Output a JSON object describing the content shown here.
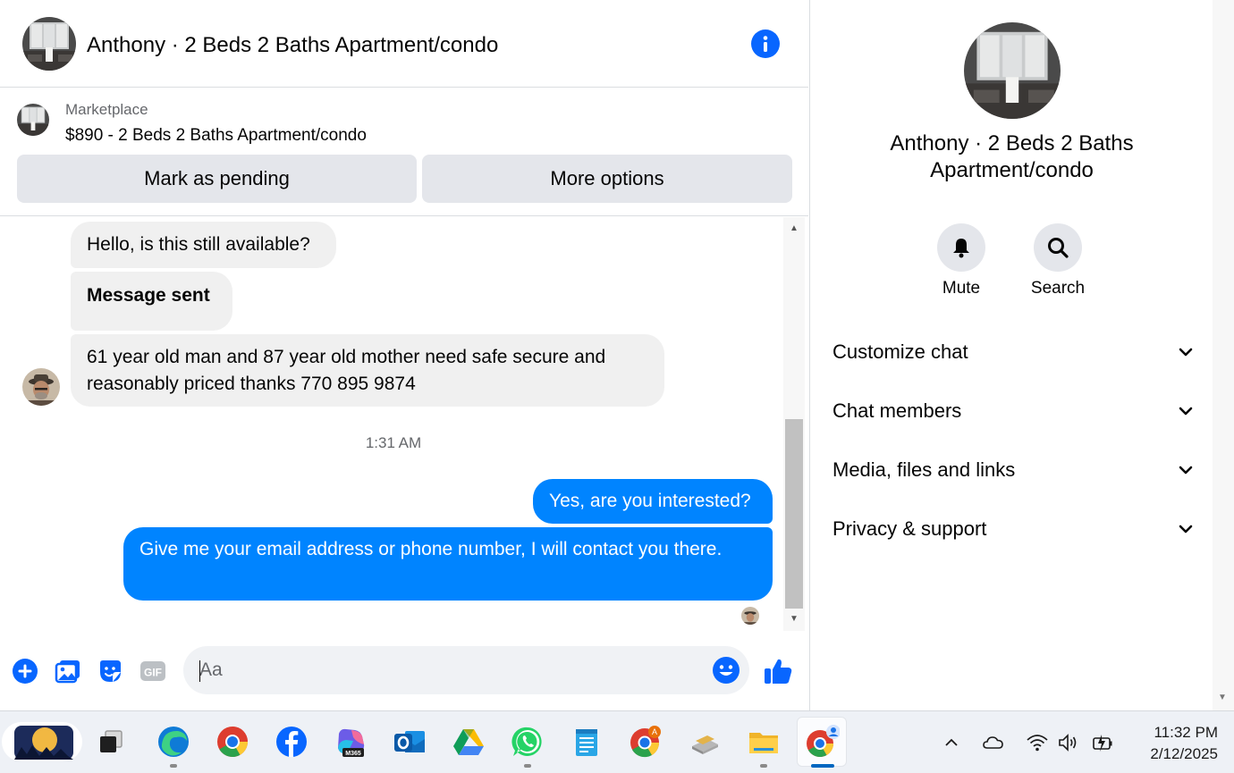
{
  "header": {
    "title": "Anthony · 2 Beds 2 Baths Apartment/condo"
  },
  "marketplace": {
    "label": "Marketplace",
    "listing": "$890 - 2 Beds 2 Baths Apartment/condo",
    "mark_pending_label": "Mark as pending",
    "more_options_label": "More options"
  },
  "messages": {
    "incoming": [
      "Hello, is this still available?",
      "Message sent",
      "61 year old man  and 87 year old mother need safe secure  and reasonably priced  thanks 770 895 9874"
    ],
    "timestamp": "1:31 AM",
    "outgoing": [
      "Yes, are you interested?",
      "Give me your email address or phone number, I will contact you there."
    ]
  },
  "composer": {
    "placeholder": "Aa",
    "gif_label": "GIF"
  },
  "panel": {
    "title": "Anthony · 2 Beds 2 Baths Apartment/condo",
    "actions": {
      "mute_label": "Mute",
      "search_label": "Search"
    },
    "sections": [
      "Customize chat",
      "Chat members",
      "Media, files and links",
      "Privacy & support"
    ]
  },
  "taskbar": {
    "m365_badge": "M365",
    "chrome_badge": "A",
    "time": "11:32 PM",
    "date": "2/12/2025"
  },
  "colors": {
    "accent": "#0866ff",
    "outgoing_bubble": "#0084ff",
    "incoming_bubble": "#f0f0f0",
    "button_grey": "#e4e6eb"
  }
}
